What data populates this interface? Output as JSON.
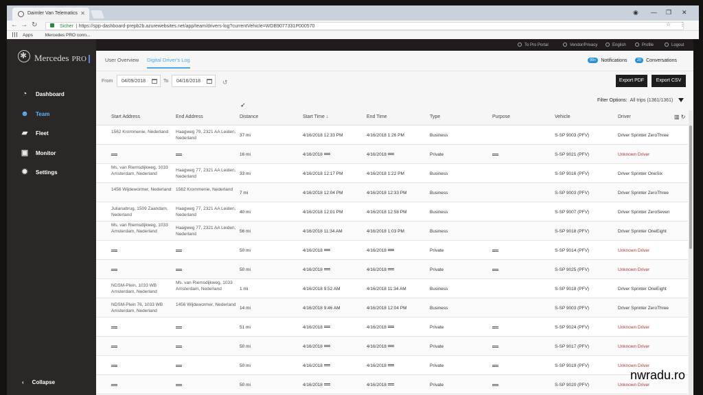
{
  "browser": {
    "tab_title": "Daimler Van Telematics",
    "secure_label": "Sicher",
    "url": "https://spp-dashboard-prepb2b.azurewebsites.net/app/team/drivers-log?currentVehicle=WDB9077331P000570",
    "bookmarks": [
      "Apps",
      "Mercedes PRO conn..."
    ]
  },
  "brand": {
    "name": "Mercedes",
    "sub": "PRO"
  },
  "sidebar": {
    "items": [
      {
        "label": "Dashboard",
        "icon": "speedometer-icon",
        "glyph": "◔",
        "active": false
      },
      {
        "label": "Team",
        "icon": "people-icon",
        "glyph": "☻",
        "active": true
      },
      {
        "label": "Fleet",
        "icon": "truck-icon",
        "glyph": "▰",
        "active": false
      },
      {
        "label": "Monitor",
        "icon": "monitor-icon",
        "glyph": "▣",
        "active": false
      },
      {
        "label": "Settings",
        "icon": "gear-icon",
        "glyph": "✹",
        "active": false
      }
    ],
    "collapse_label": "Collapse"
  },
  "utilbar": {
    "pro_portal": "To Pro Portal",
    "vendor": "Vendor/Privacy",
    "language": "English",
    "profile": "Profile",
    "logout": "Logout"
  },
  "header": {
    "tabs": [
      "User Overview",
      "Digital Driver's Log"
    ],
    "notifications_badge": "99+",
    "notifications_label": "Notifications",
    "conversations_badge": "20",
    "conversations_label": "Conversations"
  },
  "filters": {
    "from_label": "From",
    "from_value": "04/09/2018",
    "to_label": "To",
    "to_value": "04/16/2018",
    "export_pdf": "Export PDF",
    "export_csv": "Export CSV",
    "filter_options_label": "Filter Options:",
    "filter_count": "All trips (1361/1361)"
  },
  "table": {
    "headers": [
      "Start Address",
      "End Address",
      "Distance",
      "Start Time ↓",
      "End Time",
      "Type",
      "Purpose",
      "Vehicle",
      "Driver"
    ],
    "rows": [
      [
        "1562 Krommenie, Nederland",
        "Haagweg 79, 2321 AA Leiden, Nederland",
        "37 mi",
        "4/16/2018 12:33 PM",
        "4/16/2018 1:26 PM",
        "Business",
        "",
        "S-SP 9003 (PFV)",
        "Driver Sprinter ZeroThree"
      ],
      [
        "",
        "",
        "16 mi",
        "4/16/2018",
        "4/16/2018",
        "Private",
        "",
        "S-SP 9021 (PFV)",
        "Unknown Driver"
      ],
      [
        "Ms. van Riemsdijkweg, 1033 Amsterdam, Nederland",
        "Haagweg 77, 2321 AA Leiden, Nederland",
        "33 mi",
        "4/16/2018 12:17 PM",
        "4/16/2018 1:22 PM",
        "Business",
        "",
        "S-SP 9016 (PFV)",
        "Driver Sprinter OneSix"
      ],
      [
        "1456 Wijdewormer, Nederland",
        "1562 Krommenie, Nederland",
        "7 mi",
        "4/16/2018 12:04 PM",
        "4/16/2018 12:33 PM",
        "Business",
        "",
        "S-SP 9003 (PFV)",
        "Driver Sprinter ZeroThree"
      ],
      [
        "Julianabrug, 1509 Zaandam, Nederland",
        "Haagweg 77, 2321 AA Leiden, Nederland",
        "40 mi",
        "4/16/2018 12:01 PM",
        "4/16/2018 12:58 PM",
        "Business",
        "",
        "S-SP 9007 (PFV)",
        "Driver Sprinter ZeroSeven"
      ],
      [
        "Ms. van Riemsdijkweg, 1033 Amsterdam, Nederland",
        "Haagweg 77, 2321 AA Leiden, Nederland",
        "56 mi",
        "4/16/2018 11:34 AM",
        "4/16/2018 1:03 PM",
        "Business",
        "",
        "S-SP 9018 (PFV)",
        "Driver Sprinter OneEight"
      ],
      [
        "",
        "",
        "50 mi",
        "4/16/2018",
        "4/16/2018",
        "Private",
        "",
        "S-SP 9014 (PFV)",
        "Unknown Driver"
      ],
      [
        "",
        "",
        "50 mi",
        "4/16/2018",
        "4/16/2018",
        "Private",
        "",
        "S-SP 9025 (PFV)",
        "Unknown Driver"
      ],
      [
        "NDSM-Plein, 1033 WB Amsterdam, Nederland",
        "Ms. van Riemsdijkweg, 1033 Amsterdam, Nederland",
        "1 mi",
        "4/16/2018 9:52 AM",
        "4/16/2018 11:34 AM",
        "Business",
        "",
        "S-SP 9018 (PFV)",
        "Driver Sprinter OneEight"
      ],
      [
        "NDSM-Plein 76, 1033 WB Amsterdam, Nederland",
        "1456 Wijdewormer, Nederland",
        "14 mi",
        "4/16/2018 9:46 AM",
        "4/16/2018 12:04 PM",
        "Business",
        "",
        "S-SP 9003 (PFV)",
        "Driver Sprinter ZeroThree"
      ],
      [
        "",
        "",
        "51 mi",
        "4/16/2018",
        "4/16/2018",
        "Private",
        "",
        "S-SP 9024 (PFV)",
        "Unknown Driver"
      ],
      [
        "",
        "",
        "50 mi",
        "4/16/2018",
        "4/16/2018",
        "Private",
        "",
        "S-SP 9017 (PFV)",
        "Unknown Driver"
      ],
      [
        "",
        "",
        "50 mi",
        "4/16/2018",
        "4/16/2018",
        "Private",
        "",
        "S-SP 9019 (PFV)",
        "Unknown Driver"
      ],
      [
        "",
        "",
        "50 mi",
        "4/16/2018",
        "4/16/2018",
        "Private",
        "",
        "S-SP 9020 (PFV)",
        "Unknown Driver"
      ]
    ]
  },
  "watermark": "nwradu.ro"
}
